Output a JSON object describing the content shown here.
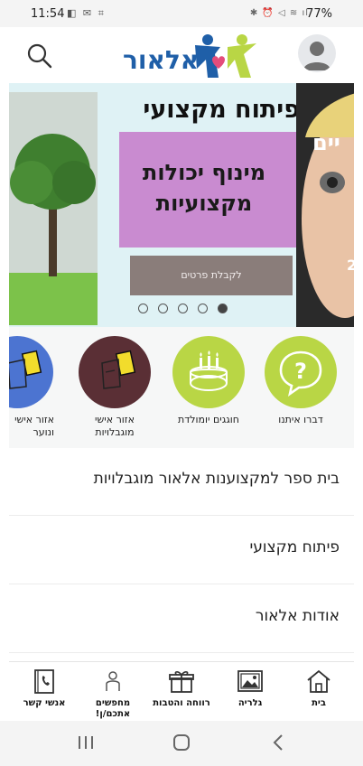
{
  "status_bar": {
    "time": "11:54",
    "battery": "77%"
  },
  "header": {
    "logo_text": "אלאור"
  },
  "carousel": {
    "title": "פיתוח מקצועי",
    "box_text_line1": "מינוף יכולות",
    "box_text_line2": "מקצועיות",
    "cta_label": "לקבלת פרטים",
    "peek_text": "יים",
    "peek_number": "2",
    "slide_count": 5,
    "active_index": 4
  },
  "categories": [
    {
      "label": "דברו איתנו",
      "icon": "question-bubble-icon",
      "color": "#b9d645"
    },
    {
      "label": "חוגגים יומולדת",
      "icon": "birthday-cake-icon",
      "color": "#b9d645"
    },
    {
      "label_line1": "אזור אישי",
      "label_line2": "מוגבלויות",
      "icon": "card-reader-icon",
      "color": "#5a2f35"
    },
    {
      "label_line1": "אזור אישי",
      "label_line2": "ונוער",
      "icon": "card-reader-icon",
      "color": "#4c74d1"
    }
  ],
  "menu": [
    {
      "label": "בית ספר למקצוענות אלאור מוגבלויות"
    },
    {
      "label": "פיתוח מקצועי"
    },
    {
      "label": "אודות אלאור"
    }
  ],
  "bottom_nav": [
    {
      "label": "בית",
      "icon": "home-icon"
    },
    {
      "label": "גלריה",
      "icon": "gallery-icon"
    },
    {
      "label": "רווחה והטבות",
      "icon": "gift-icon"
    },
    {
      "label_line1": "מחפשים",
      "label_line2": "אתכם/ן!",
      "icon": "person-search-icon"
    },
    {
      "label": "אנשי קשר",
      "icon": "phone-book-icon"
    }
  ],
  "colors": {
    "accent_green": "#b9d645",
    "brand_blue": "#1f5fa8",
    "carousel_bg": "#dff2f5",
    "purple": "#c98bd0"
  }
}
